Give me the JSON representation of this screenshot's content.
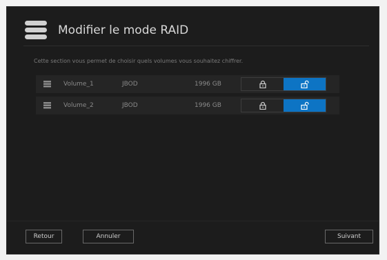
{
  "dialog": {
    "title": "Modifier le mode RAID",
    "description": "Cette section vous permet de choisir quels volumes vous souhaitez chiffrer.",
    "header_icon": "database-icon"
  },
  "volumes": [
    {
      "name": "Volume_1",
      "type": "JBOD",
      "size": "1996 GB",
      "encryption": "unlocked"
    },
    {
      "name": "Volume_2",
      "type": "JBOD",
      "size": "1996 GB",
      "encryption": "unlocked"
    }
  ],
  "buttons": {
    "back": "Retour",
    "cancel": "Annuler",
    "next": "Suivant"
  },
  "colors": {
    "accent": "#0d74c4",
    "background": "#1c1c1c",
    "row": "#252525"
  }
}
